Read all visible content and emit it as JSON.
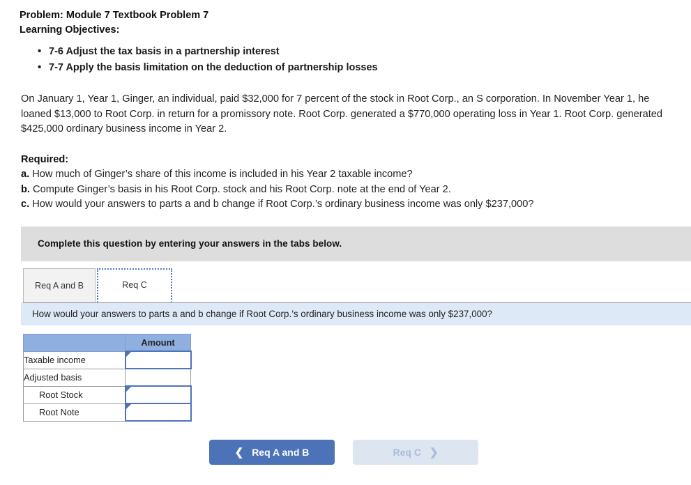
{
  "problem": {
    "title": "Problem: Module 7 Textbook Problem 7",
    "objectives_label": "Learning Objectives:",
    "objectives": [
      "7-6 Adjust the tax basis in a partnership interest",
      "7-7 Apply the basis limitation on the deduction of partnership losses"
    ],
    "narrative": "On January 1, Year 1, Ginger, an individual, paid $32,000 for 7 percent of the stock in Root Corp., an S corporation. In November Year 1, he loaned $13,000 to Root Corp. in return for a promissory note. Root Corp. generated a $770,000 operating loss in Year 1. Root Corp. generated $425,000 ordinary business income in Year 2."
  },
  "required": {
    "heading": "Required:",
    "items": [
      {
        "letter": "a.",
        "text": "How much of Ginger’s share of this income is included in his Year 2 taxable income?"
      },
      {
        "letter": "b.",
        "text": "Compute Ginger’s basis in his Root Corp. stock and his Root Corp. note at the end of Year 2."
      },
      {
        "letter": "c.",
        "text": "How would your answers to parts a and b change if Root Corp.’s ordinary business income was only $237,000?"
      }
    ]
  },
  "instruction_strip": {
    "text": "Complete this question by entering your answers in the tabs below."
  },
  "tabs": [
    {
      "id": "req-a-and-b",
      "label": "Req A and B",
      "active": false
    },
    {
      "id": "req-c",
      "label": "Req C",
      "active": true
    }
  ],
  "question_banner": {
    "text": "How would your answers to parts a and b change if Root Corp.’s ordinary business income was only $237,000?"
  },
  "answer_table": {
    "columns": [
      "",
      "Amount"
    ],
    "rows": [
      {
        "label": "Taxable income",
        "indent": false,
        "cell": "input",
        "value": ""
      },
      {
        "label": "Adjusted basis",
        "indent": false,
        "cell": "empty",
        "value": ""
      },
      {
        "label": "Root Stock",
        "indent": true,
        "cell": "input",
        "value": ""
      },
      {
        "label": "Root Note",
        "indent": true,
        "cell": "input",
        "value": ""
      }
    ]
  },
  "nav": {
    "prev_label": "Req A and B",
    "prev_icon": "chevron-left-icon",
    "next_label": "Req C",
    "next_icon": "chevron-right-icon"
  },
  "colors": {
    "primary_blue": "#4c73b8",
    "table_header_blue": "#8fafe0",
    "banner_blue": "#dee9f7",
    "strip_gray": "#dddddd",
    "input_border": "#4e74b8",
    "next_disabled_bg": "#dde5f0",
    "next_disabled_text": "#a9bcd8"
  }
}
